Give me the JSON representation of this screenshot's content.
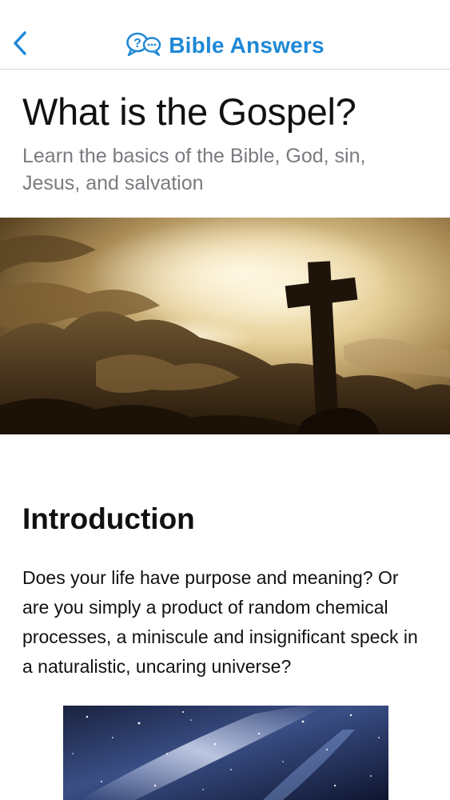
{
  "navbar": {
    "back_icon": "chevron-left-icon",
    "logo_icon": "speech-bubble-question-icon",
    "title": "Bible Answers",
    "accent_color": "#1e88d6"
  },
  "article": {
    "title": "What is the Gospel?",
    "subtitle": "Learn the basics of the Bible, God, sin, Jesus, and salvation",
    "hero_image": "cross-silhouette-sunset-clouds",
    "section_heading": "Introduction",
    "intro_text": "Does your life have purpose and meaning? Or are you simply a product of random chemical processes, a miniscule and insignificant speck in a naturalistic, uncaring universe?",
    "secondary_image": "milky-way-galaxy-night-sky"
  }
}
